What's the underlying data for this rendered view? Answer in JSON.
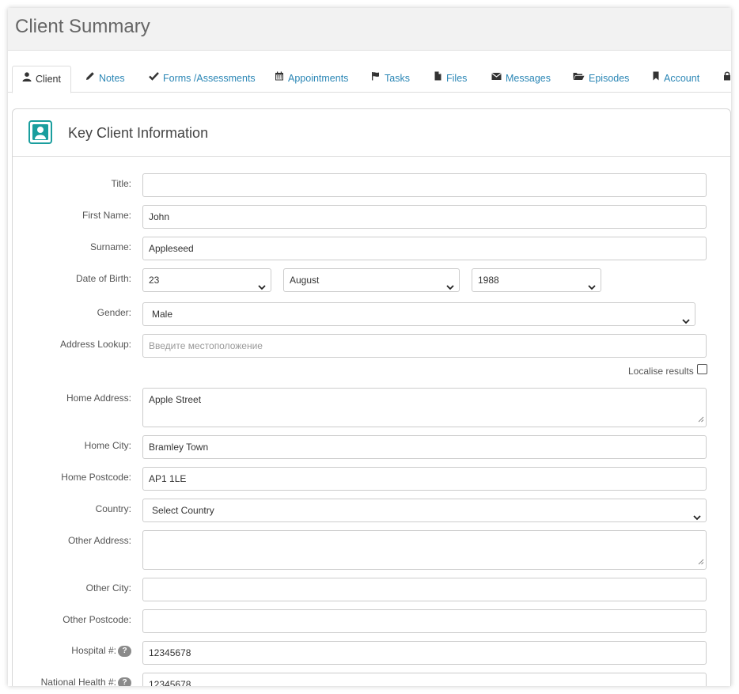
{
  "page": {
    "title": "Client Summary"
  },
  "tabs": [
    {
      "label": "Client",
      "icon": "user-icon"
    },
    {
      "label": "Notes",
      "icon": "pencil-icon"
    },
    {
      "label": "Forms /Assessments",
      "icon": "check-icon"
    },
    {
      "label": "Appointments",
      "icon": "calendar-icon"
    },
    {
      "label": "Tasks",
      "icon": "flag-icon"
    },
    {
      "label": "Files",
      "icon": "file-icon"
    },
    {
      "label": "Messages",
      "icon": "envelope-icon"
    },
    {
      "label": "Episodes",
      "icon": "folder-open-icon"
    },
    {
      "label": "Account",
      "icon": "bookmark-icon"
    }
  ],
  "panel": {
    "title": "Key Client Information",
    "icon": "client-card-icon"
  },
  "form": {
    "title": {
      "label": "Title:",
      "value": ""
    },
    "first_name": {
      "label": "First Name:",
      "value": "John"
    },
    "surname": {
      "label": "Surname:",
      "value": "Appleseed"
    },
    "dob": {
      "label": "Date of Birth:",
      "day": "23",
      "month": "August",
      "year": "1988"
    },
    "gender": {
      "label": "Gender:",
      "value": "Male"
    },
    "address_lookup": {
      "label": "Address Lookup:",
      "placeholder": "Введите местоположение",
      "localise_label": "Localise results",
      "localise_checked": false
    },
    "home_address": {
      "label": "Home Address:",
      "value": "Apple Street"
    },
    "home_city": {
      "label": "Home City:",
      "value": "Bramley Town"
    },
    "home_postcode": {
      "label": "Home Postcode:",
      "value": "AP1 1LE"
    },
    "country": {
      "label": "Country:",
      "value": "Select Country"
    },
    "other_address": {
      "label": "Other Address:",
      "value": ""
    },
    "other_city": {
      "label": "Other City:",
      "value": ""
    },
    "other_postcode": {
      "label": "Other Postcode:",
      "value": ""
    },
    "hospital": {
      "label": "Hospital #:",
      "value": "12345678",
      "help": "?"
    },
    "national_health": {
      "label": "National Health #:",
      "value": "12345678",
      "help": "?"
    }
  },
  "colors": {
    "accent": "#2a86b5",
    "panel_icon": "#1a9e9e"
  }
}
